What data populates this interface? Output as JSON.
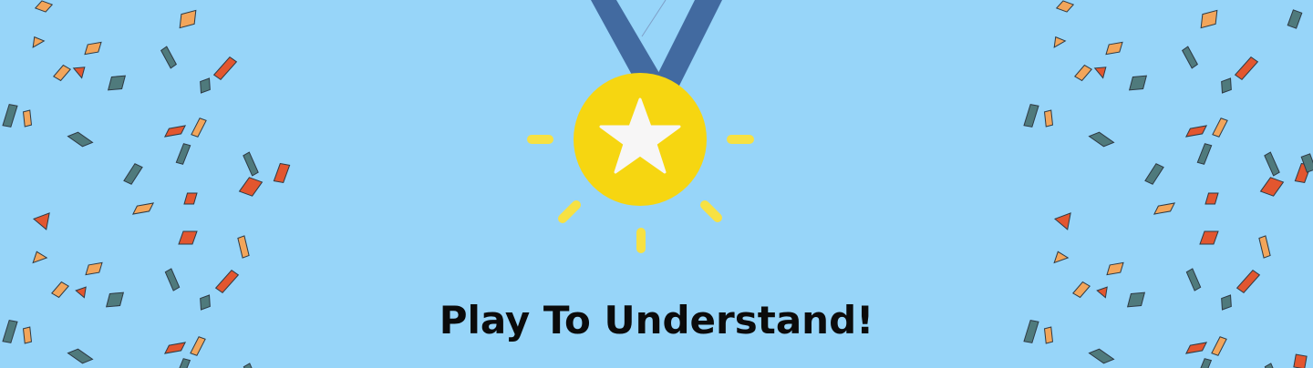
{
  "banner": {
    "headline": "Play To Understand!"
  },
  "colors": {
    "background": "#97d5f9",
    "ribbon": "#426aa0",
    "medal": "#f6d611",
    "star": "#f7f6f6",
    "rays": "#f7e142",
    "text": "#0b0b0b",
    "confetti_teal": "#4f7a7c",
    "confetti_orange": "#f2a55a",
    "confetti_red": "#e2562f",
    "confetti_outline": "#2e3a44"
  },
  "icons": {
    "medal": "medal-icon",
    "star": "star-icon",
    "confetti": "confetti-icon"
  }
}
